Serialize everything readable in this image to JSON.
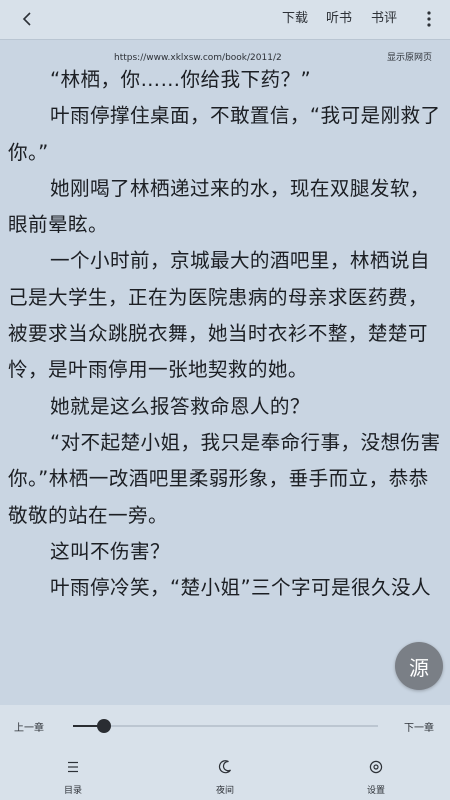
{
  "header": {
    "download_label": "下载",
    "listen_label": "听书",
    "review_label": "书评"
  },
  "source": {
    "url": "https://www.xklxsw.com/book/2011/2",
    "show_original_label": "显示原网页"
  },
  "content": {
    "paragraphs": [
      "“林栖，你……你给我下药？”",
      "叶雨停撑住桌面，不敢置信，“我可是刚救了你。”",
      "她刚喝了林栖递过来的水，现在双腿发软，眼前晕眩。",
      "一个小时前，京城最大的酒吧里，林栖说自己是大学生，正在为医院患病的母亲求医药费，被要求当众跳脱衣舞，她当时衣衫不整，楚楚可怜，是叶雨停用一张地契救的她。",
      "她就是这么报答救命恩人的？",
      "“对不起楚小姐，我只是奉命行事，没想伤害你。”林栖一改酒吧里柔弱形象，垂手而立，恭恭敬敬的站在一旁。",
      "这叫不伤害？",
      "叶雨停冷笑，“楚小姐”三个字可是很久没人"
    ]
  },
  "fab": {
    "label": "源"
  },
  "progress": {
    "prev_label": "上一章",
    "next_label": "下一章",
    "value": 0.1
  },
  "bottom_nav": {
    "items": [
      {
        "label": "目录",
        "icon": "list-icon"
      },
      {
        "label": "夜间",
        "icon": "moon-icon"
      },
      {
        "label": "设置",
        "icon": "settings-icon"
      }
    ]
  },
  "colors": {
    "background": "#c9d5e2",
    "bar": "#d8e1ea",
    "text": "#1c1f24",
    "fab": "#7a7f86"
  }
}
